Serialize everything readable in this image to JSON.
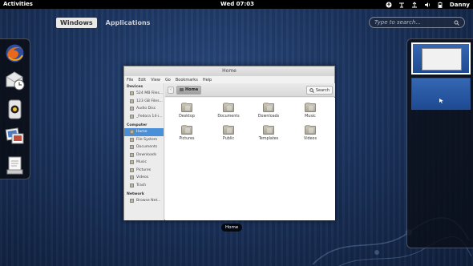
{
  "topbar": {
    "activities_label": "Activities",
    "clock": "Wed 07:03",
    "user_name": "Danny",
    "tray_icons": [
      "accessibility-icon",
      "keyboard-layout-icon",
      "network-icon",
      "volume-icon",
      "battery-icon"
    ]
  },
  "overview": {
    "tabs": [
      {
        "label": "Windows",
        "active": true
      },
      {
        "label": "Applications",
        "active": false
      }
    ],
    "search_placeholder": "Type to search...",
    "window_caption": "Home"
  },
  "dash": {
    "items": [
      "firefox-icon",
      "evolution-mail-icon",
      "rhythmbox-icon",
      "shotwell-photos-icon",
      "document-viewer-icon"
    ]
  },
  "workspaces": [
    {
      "name": "workspace-1",
      "active": true
    },
    {
      "name": "workspace-2",
      "active": false
    }
  ],
  "nautilus": {
    "title": "Home",
    "menu": [
      "File",
      "Edit",
      "View",
      "Go",
      "Bookmarks",
      "Help"
    ],
    "path_button": "Home",
    "search_label": "Search",
    "sidebar": {
      "devices_header": "Devices",
      "devices": [
        "524 MB Files...",
        "123 GB Files...",
        "Audio Disc",
        "_Fedora 14-i..."
      ],
      "computer_header": "Computer",
      "computer": [
        "Home",
        "File System",
        "Documents",
        "Downloads",
        "Music",
        "Pictures",
        "Videos",
        "Trash"
      ],
      "network_header": "Network",
      "network": [
        "Browse Net..."
      ]
    },
    "files": [
      "Desktop",
      "Documents",
      "Downloads",
      "Music",
      "Pictures",
      "Public",
      "Templates",
      "Videos"
    ]
  },
  "colors": {
    "topbar": "#000000",
    "background": "#1b335d",
    "selection": "#4a90d9"
  }
}
